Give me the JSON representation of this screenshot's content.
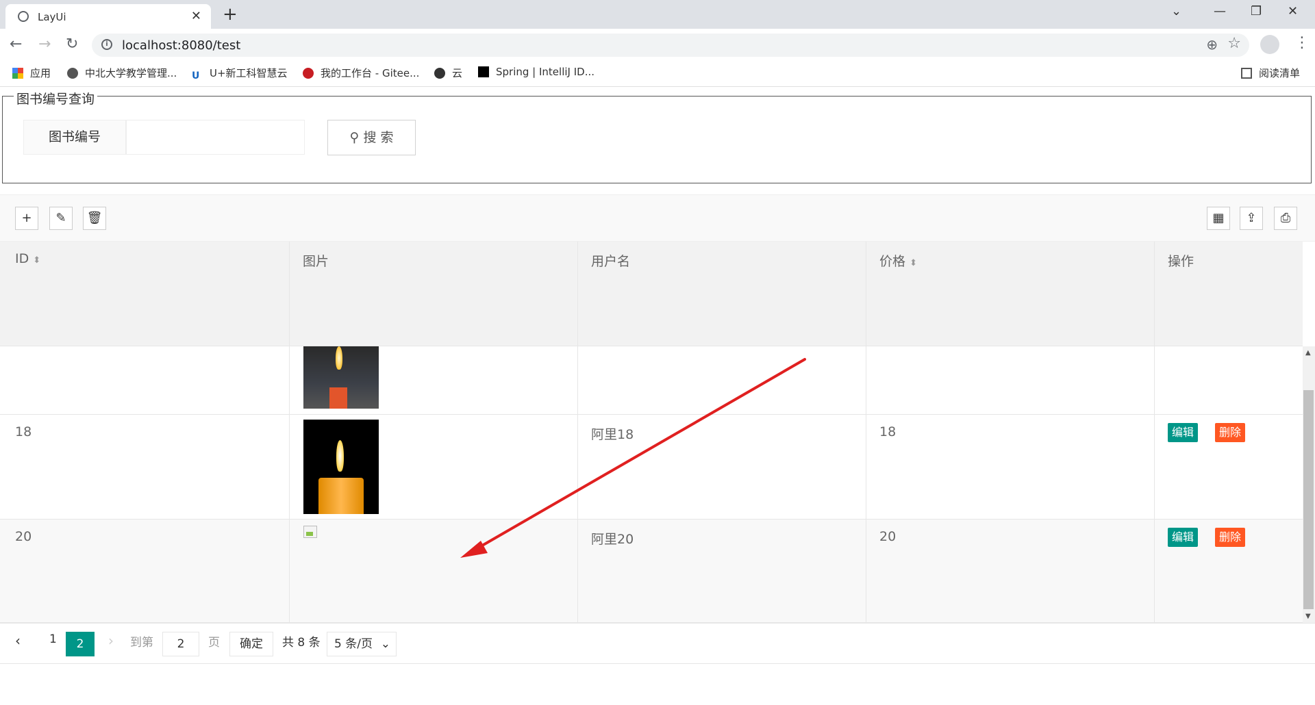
{
  "browser": {
    "tab_title": "LayUi",
    "url": "localhost:8080/test",
    "bookmarks": [
      "应用",
      "中北大学教学管理...",
      "U+新工科智慧云",
      "我的工作台 - Gitee...",
      "云",
      "Spring | IntelliJ ID..."
    ],
    "reading_list": "阅读清单"
  },
  "search": {
    "legend": "图书编号查询",
    "label": "图书编号",
    "input_value": "",
    "button_label": "搜 索"
  },
  "table": {
    "columns": [
      "ID",
      "图片",
      "用户名",
      "价格",
      "操作"
    ],
    "rows": [
      {
        "id": "",
        "username": "",
        "price": "",
        "image": "candle-small"
      },
      {
        "id": "18",
        "username": "阿里18",
        "price": "18",
        "image": "candle",
        "edit": "编辑",
        "delete": "删除"
      },
      {
        "id": "20",
        "username": "阿里20",
        "price": "20",
        "image": "broken-image",
        "edit": "编辑",
        "delete": "删除"
      }
    ]
  },
  "pager": {
    "prev": "<",
    "page1": "1",
    "current": "2",
    "next": ">",
    "goto_label": "到第",
    "goto_value": "2",
    "page_unit": "页",
    "confirm": "确定",
    "total": "共 8 条",
    "limit": "5 条/页"
  },
  "colors": {
    "accent": "#009688",
    "danger": "#ff5722",
    "arrow": "#e02020"
  }
}
